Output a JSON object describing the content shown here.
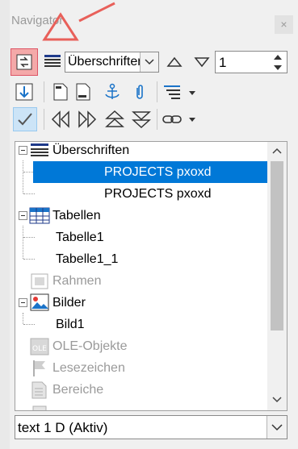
{
  "window": {
    "title": "Navigator",
    "close_label": "×"
  },
  "toolbar": {
    "heading_level_combo": "Überschriften",
    "page_number": "1"
  },
  "tree": {
    "items": [
      {
        "label": "Überschriften",
        "type": "category",
        "state": "expanded"
      },
      {
        "label": "PROJECTS pxoxd",
        "type": "child",
        "selected": true
      },
      {
        "label": "PROJECTS pxoxd",
        "type": "child",
        "selected": false
      },
      {
        "label": "Tabellen",
        "type": "category",
        "state": "expanded"
      },
      {
        "label": "Tabelle1",
        "type": "child"
      },
      {
        "label": "Tabelle1_1",
        "type": "child"
      },
      {
        "label": "Rahmen",
        "type": "category",
        "state": "disabled"
      },
      {
        "label": "Bilder",
        "type": "category",
        "state": "expanded"
      },
      {
        "label": "Bild1",
        "type": "child"
      },
      {
        "label": "OLE-Objekte",
        "type": "category",
        "state": "disabled"
      },
      {
        "label": "Lesezeichen",
        "type": "category",
        "state": "disabled"
      },
      {
        "label": "Bereiche",
        "type": "category",
        "state": "disabled"
      }
    ]
  },
  "document_select": {
    "value": "text 1 D (Aktiv)"
  },
  "colors": {
    "selection": "#0078d7",
    "highlight_button": "#f4a9a9",
    "annotation_arrow": "#e8605a"
  }
}
